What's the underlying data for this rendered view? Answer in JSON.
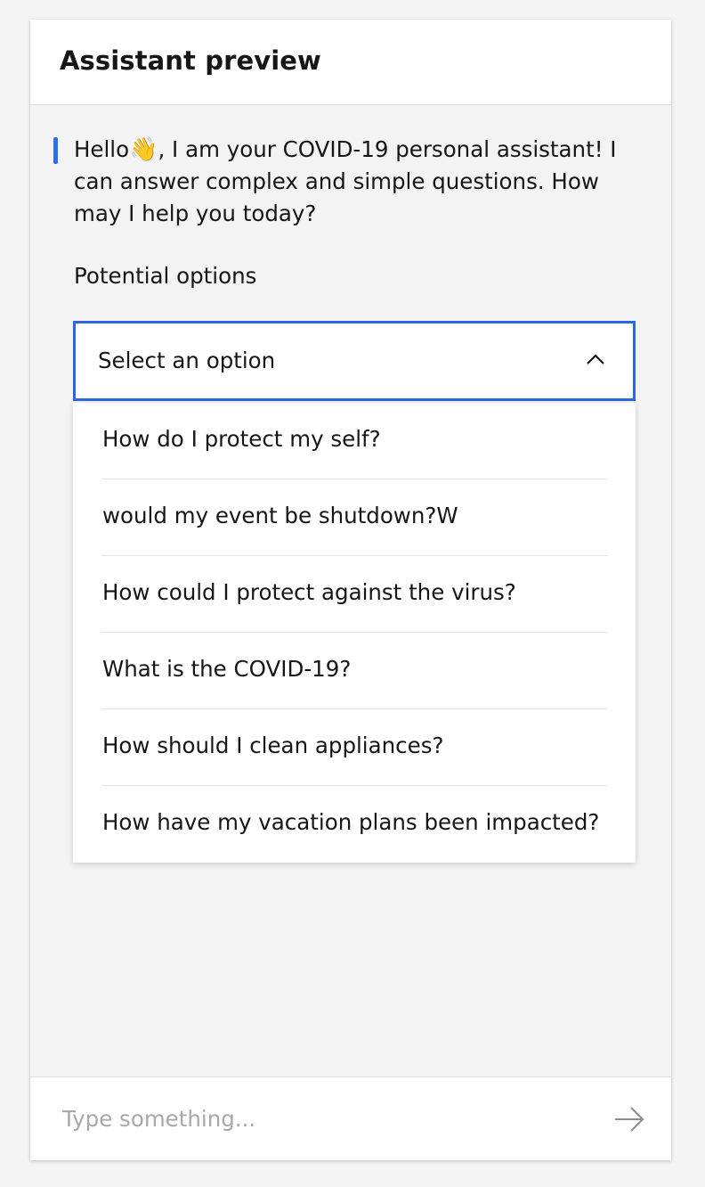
{
  "header": {
    "title": "Assistant preview"
  },
  "message": {
    "text_before_icon": "Hello",
    "icon": "waving-hand-icon",
    "icon_glyph": "👋",
    "text_after_icon": ", I am your COVID-19 personal assistant! I can answer complex and simple questions. How may I help you today?"
  },
  "options": {
    "label": "Potential options",
    "selected_value": "Select an option",
    "items": [
      "How do I protect my self?",
      "would my event be shutdown?W",
      "How could I protect against the virus?",
      "What is the COVID-19?",
      "How should I clean appliances?",
      "How have my vacation plans been impacted?"
    ]
  },
  "input": {
    "placeholder": "Type something...",
    "value": ""
  },
  "colors": {
    "accent": "#2f6fe4",
    "background": "#f3f3f3",
    "surface": "#ffffff"
  }
}
